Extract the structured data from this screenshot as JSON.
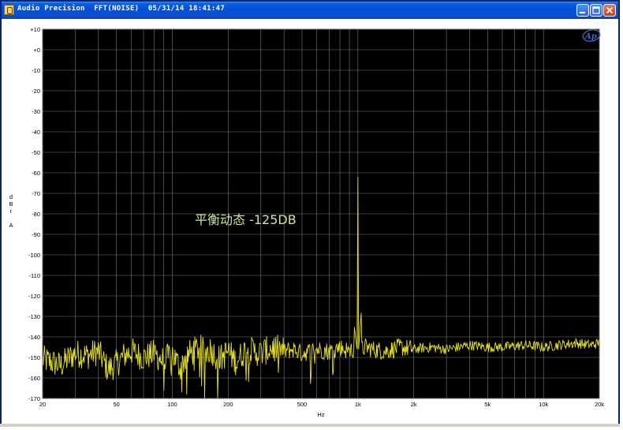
{
  "window": {
    "title": "Audio Precision  FFT(NOISE)  05/31/14 18:41:47",
    "buttons": [
      "minimize",
      "maximize",
      "close"
    ]
  },
  "logo": "Ap",
  "chart_data": {
    "type": "line",
    "x_scale": "log",
    "xlim": [
      20,
      20000
    ],
    "ylim": [
      -170,
      10
    ],
    "xlabel": "Hz",
    "ylabel": "d B r A",
    "x_ticks": [
      {
        "v": 20,
        "t": "20"
      },
      {
        "v": 50,
        "t": "50"
      },
      {
        "v": 100,
        "t": "100"
      },
      {
        "v": 200,
        "t": "200"
      },
      {
        "v": 500,
        "t": "500"
      },
      {
        "v": 1000,
        "t": "1k"
      },
      {
        "v": 2000,
        "t": "2k"
      },
      {
        "v": 5000,
        "t": "5k"
      },
      {
        "v": 10000,
        "t": "10k"
      },
      {
        "v": 20000,
        "t": "20k"
      }
    ],
    "y_ticks": [
      {
        "v": 10,
        "t": "+10"
      },
      {
        "v": 0,
        "t": "+0"
      },
      {
        "v": -10,
        "t": "-10"
      },
      {
        "v": -20,
        "t": "-20"
      },
      {
        "v": -30,
        "t": "-30"
      },
      {
        "v": -40,
        "t": "-40"
      },
      {
        "v": -50,
        "t": "-50"
      },
      {
        "v": -60,
        "t": "-60"
      },
      {
        "v": -70,
        "t": "-70"
      },
      {
        "v": -80,
        "t": "-80"
      },
      {
        "v": -90,
        "t": "-90"
      },
      {
        "v": -100,
        "t": "-100"
      },
      {
        "v": -110,
        "t": "-110"
      },
      {
        "v": -120,
        "t": "-120"
      },
      {
        "v": -130,
        "t": "-130"
      },
      {
        "v": -140,
        "t": "-140"
      },
      {
        "v": -150,
        "t": "-150"
      },
      {
        "v": -160,
        "t": "-160"
      },
      {
        "v": -170,
        "t": "-170"
      }
    ],
    "annotation": "平衡动态 -125DB",
    "series": [
      {
        "color": "#e6e020",
        "x": [
          20,
          22,
          25,
          28,
          30,
          35,
          40,
          45,
          50,
          55,
          60,
          70,
          80,
          90,
          100,
          110,
          120,
          130,
          140,
          150,
          160,
          180,
          200,
          220,
          250,
          300,
          350,
          400,
          450,
          500,
          600,
          700,
          800,
          900,
          950,
          1000,
          1050,
          1100,
          1200,
          1400,
          1700,
          2000,
          2500,
          3000,
          4000,
          5000,
          6000,
          8000,
          10000,
          12000,
          15000,
          18000,
          20000
        ],
        "y": [
          -151,
          -152,
          -154,
          -150,
          -148,
          -149,
          -147,
          -156,
          -153,
          -149,
          -147,
          -150,
          -148,
          -152,
          -148,
          -155,
          -149,
          -147,
          -145,
          -148,
          -146,
          -151,
          -147,
          -152,
          -146,
          -148,
          -145,
          -147,
          -146,
          -148,
          -146,
          -147,
          -145,
          -147,
          -146,
          -62,
          -146,
          -145,
          -146,
          -147,
          -145,
          -146,
          -145,
          -146,
          -144,
          -145,
          -145,
          -144,
          -145,
          -144,
          -143,
          -144,
          -143
        ]
      }
    ]
  }
}
